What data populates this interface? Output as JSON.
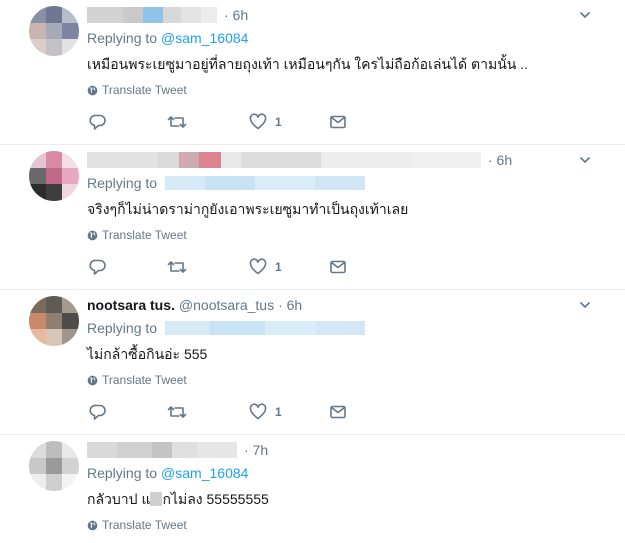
{
  "tweets": [
    {
      "username": "",
      "handle": "",
      "time": "· 6h",
      "replying_label": "Replying to",
      "replying_to": "@sam_16084",
      "text": "เหมือนพระเยซูมาอยู่ที่ลายถุงเท้า เหมือนๆกัน ใครไม่ถือก้อเล่นได้ ตามนั้น ..",
      "translate": "Translate Tweet",
      "likes": "1"
    },
    {
      "username": "",
      "handle": "",
      "time": "· 6h",
      "replying_label": "Replying to",
      "replying_to": "",
      "text": "จริงๆก็ไม่น่าดราม่ากูยังเอาพระเยซูมาทำเป็นถุงเท้าเลย",
      "translate": "Translate Tweet",
      "likes": "1"
    },
    {
      "username": "nootsara tus.",
      "handle": "@nootsara_tus",
      "time": "· 6h",
      "replying_label": "Replying to",
      "replying_to": "",
      "text": "ไม่กล้าซื้อกินอ่ะ 555",
      "translate": "Translate Tweet",
      "likes": "1"
    },
    {
      "username": "",
      "handle": "",
      "time": "· 7h",
      "replying_label": "Replying to",
      "replying_to": "@sam_16084",
      "text_before": "กลัวบาป แ",
      "text_after": "กไม่ลง 55555555",
      "translate": "Translate Tweet"
    }
  ],
  "icons": {
    "reply": "reply-icon",
    "retweet": "retweet-icon",
    "like": "heart-icon",
    "dm": "envelope-icon",
    "globe": "globe-icon",
    "menu": "chevron-down-icon"
  },
  "colors": {
    "link": "#1da1f2",
    "secondary_text": "#657786",
    "divider": "#e6ecf0"
  }
}
